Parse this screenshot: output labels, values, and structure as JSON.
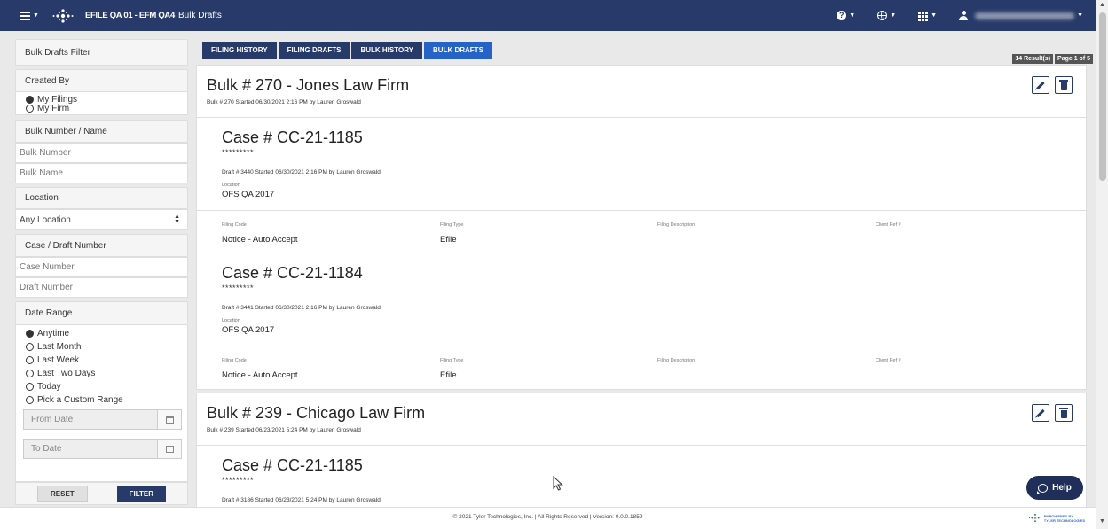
{
  "header": {
    "brand": "EFILE QA 01 - EFM QA4",
    "page_title": "Bulk Drafts",
    "icons": [
      "menu-icon",
      "help-icon",
      "globe-icon",
      "apps-grid-icon",
      "user-icon"
    ]
  },
  "sidebar": {
    "title": "Bulk Drafts Filter",
    "created_by_label": "Created By",
    "created_by_options": [
      {
        "label": "My Filings",
        "selected": true
      },
      {
        "label": "My Firm",
        "selected": false
      }
    ],
    "bulk_section_label": "Bulk Number / Name",
    "bulk_number_placeholder": "Bulk Number",
    "bulk_name_placeholder": "Bulk Name",
    "location_label": "Location",
    "location_value": "Any Location",
    "case_draft_label": "Case / Draft Number",
    "case_number_placeholder": "Case Number",
    "draft_number_placeholder": "Draft Number",
    "date_range_label": "Date Range",
    "date_range_options": [
      {
        "label": "Anytime",
        "selected": true
      },
      {
        "label": "Last Month",
        "selected": false
      },
      {
        "label": "Last Week",
        "selected": false
      },
      {
        "label": "Last Two Days",
        "selected": false
      },
      {
        "label": "Today",
        "selected": false
      },
      {
        "label": "Pick a Custom Range",
        "selected": false
      }
    ],
    "from_date_placeholder": "From Date",
    "to_date_placeholder": "To Date",
    "reset_label": "RESET",
    "filter_label": "FILTER"
  },
  "tabs": [
    {
      "label": "FILING HISTORY",
      "active": false
    },
    {
      "label": "FILING DRAFTS",
      "active": false
    },
    {
      "label": "BULK HISTORY",
      "active": false
    },
    {
      "label": "BULK DRAFTS",
      "active": true
    }
  ],
  "results": {
    "count": "14 Result(s)",
    "page": "Page 1 of 5"
  },
  "field_labels": {
    "filing_code": "Filing Code",
    "filing_type": "Filing Type",
    "filing_description": "Filing Description",
    "client_ref": "Client Ref #",
    "location": "Location"
  },
  "bulks": [
    {
      "title": "Bulk # 270 - Jones Law Firm",
      "subtitle": "Bulk # 270 Started 06/30/2021 2:16 PM by Lauren Groswald",
      "cases": [
        {
          "title": "Case # CC-21-1185",
          "mask": "*********",
          "draft_line": "Draft # 3440 Started 06/30/2021 2:16 PM by Lauren Groswald",
          "location": "OFS QA 2017",
          "filing_code": "Notice - Auto Accept",
          "filing_type": "Efile",
          "filing_description": "",
          "client_ref": ""
        },
        {
          "title": "Case # CC-21-1184",
          "mask": "*********",
          "draft_line": "Draft # 3441 Started 06/30/2021 2:16 PM by Lauren Groswald",
          "location": "OFS QA 2017",
          "filing_code": "Notice - Auto Accept",
          "filing_type": "Efile",
          "filing_description": "",
          "client_ref": ""
        }
      ]
    },
    {
      "title": "Bulk # 239 - Chicago Law Firm",
      "subtitle": "Bulk # 239 Started 06/23/2021 5:24 PM by Lauren Groswald",
      "cases": [
        {
          "title": "Case # CC-21-1185",
          "mask": "*********",
          "draft_line": "Draft # 3186 Started 06/23/2021 5:24 PM by Lauren Groswald"
        }
      ]
    }
  ],
  "footer": {
    "text": "© 2021 Tyler Technologies, Inc. | All Rights Reserved | Version: 0.0.0.1859",
    "logo_line1": "EMPOWERED BY",
    "logo_line2": "TYLER TECHNOLOGIES"
  },
  "help_label": "Help"
}
